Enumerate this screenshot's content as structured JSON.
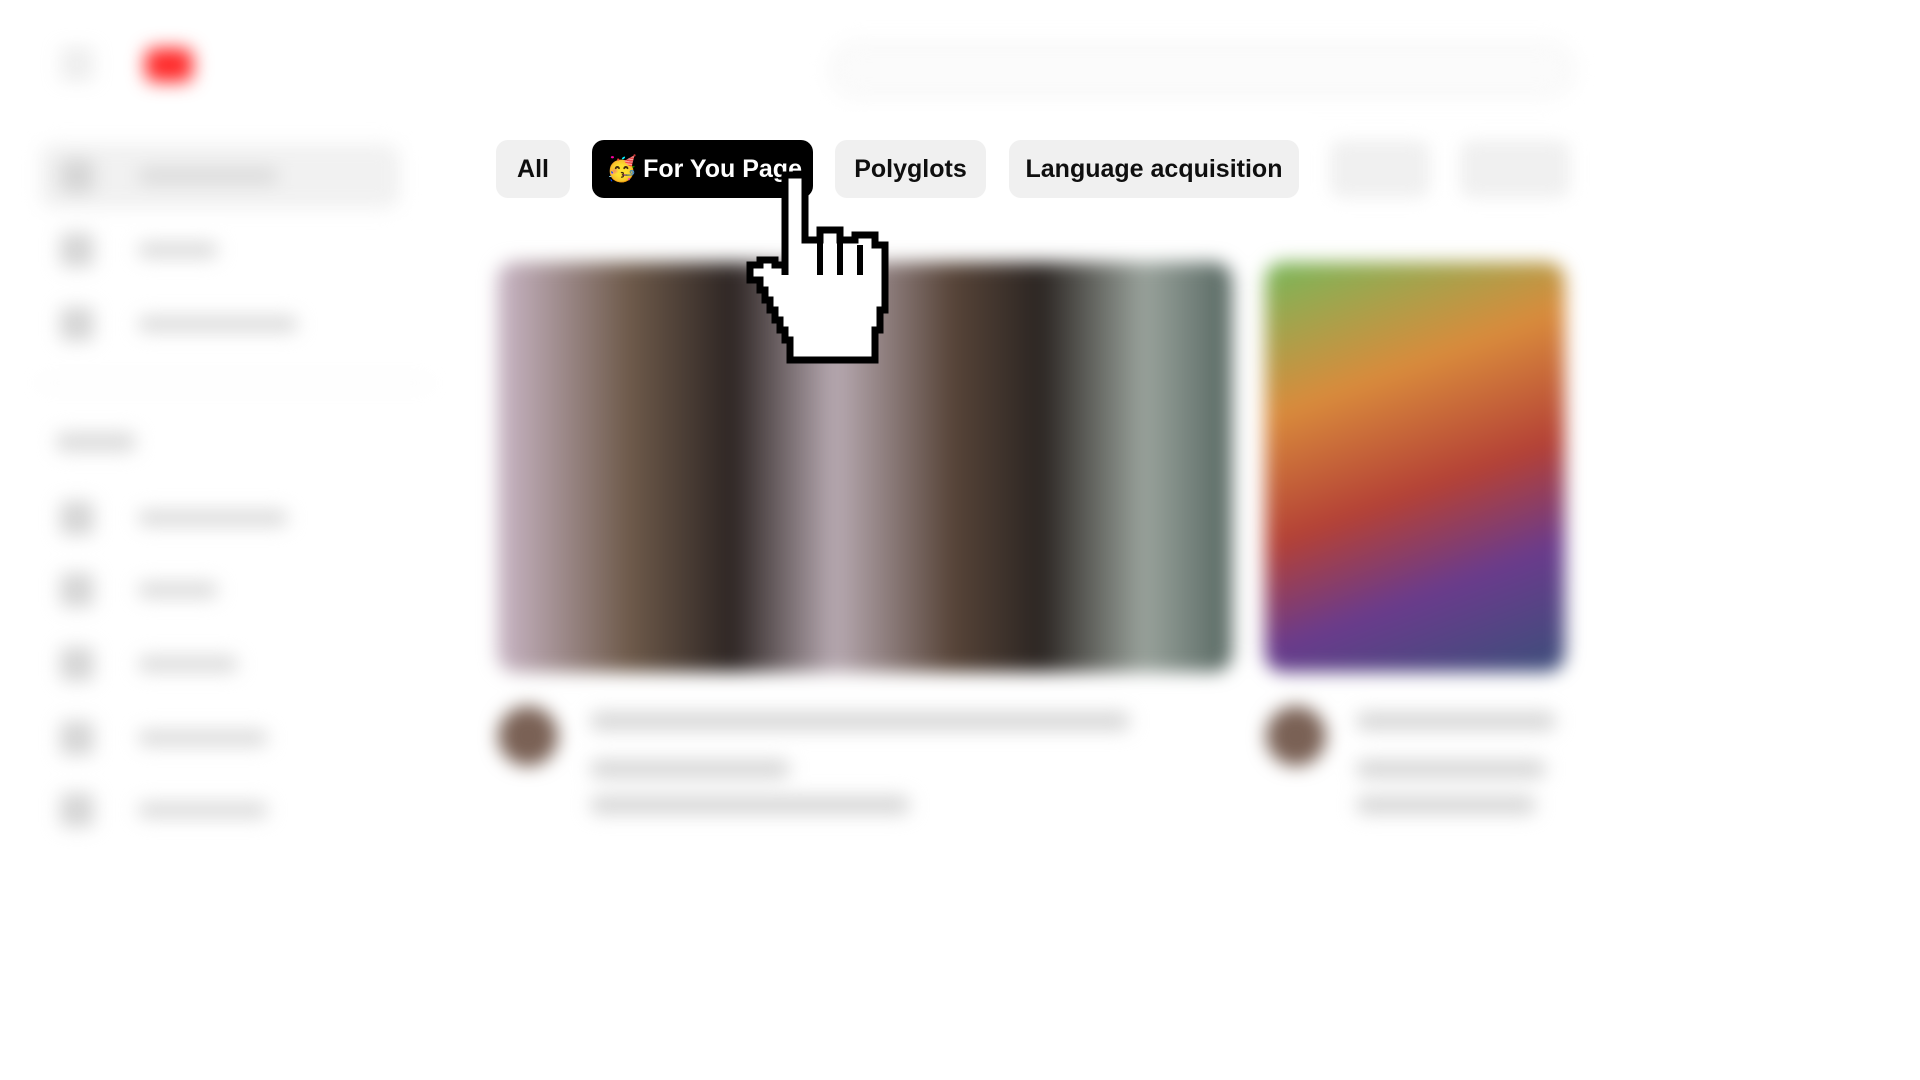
{
  "filter_chips": [
    {
      "label": "All",
      "selected": false
    },
    {
      "label": "For You Page",
      "emoji": "🥳",
      "selected": true
    },
    {
      "label": "Polyglots",
      "selected": false
    },
    {
      "label": "Language acquisition",
      "selected": false
    }
  ],
  "cursor": {
    "type": "pointer-hand"
  },
  "colors": {
    "chip_background": "#f0f0f0",
    "chip_selected_background": "#000000",
    "chip_selected_text": "#ffffff",
    "brand_red": "#ff0000"
  }
}
